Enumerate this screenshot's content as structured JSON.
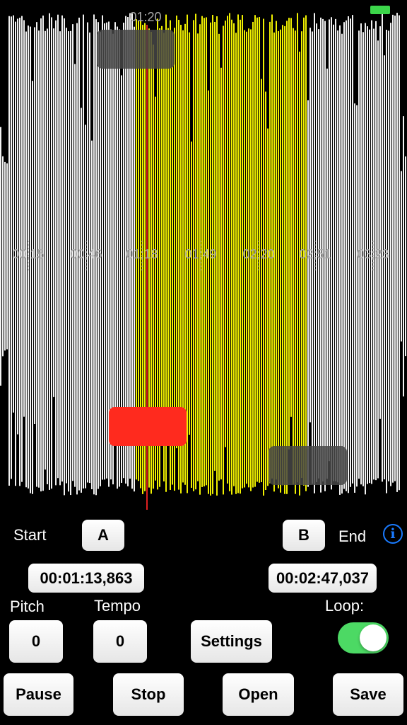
{
  "waveform": {
    "playhead_time": "01:20",
    "timeline_labels": [
      "00:15",
      "00:46",
      "01:18",
      "01:49",
      "02:20",
      "02:51",
      "03:23"
    ],
    "colors": {
      "selection": "#f0f000",
      "waveform": "#f2f2f2",
      "playhead": "#e02020"
    }
  },
  "controls": {
    "start_label": "Start",
    "a_button": "A",
    "b_button": "B",
    "end_label": "End",
    "info_icon": "i",
    "start_time": "00:01:13,863",
    "end_time": "00:02:47,037",
    "pitch_label": "Pitch",
    "tempo_label": "Tempo",
    "loop_label": "Loop:",
    "pitch_value": "0",
    "tempo_value": "0",
    "settings_button": "Settings",
    "loop_enabled": true
  },
  "toolbar": {
    "pause": "Pause",
    "stop": "Stop",
    "open": "Open",
    "save": "Save"
  }
}
